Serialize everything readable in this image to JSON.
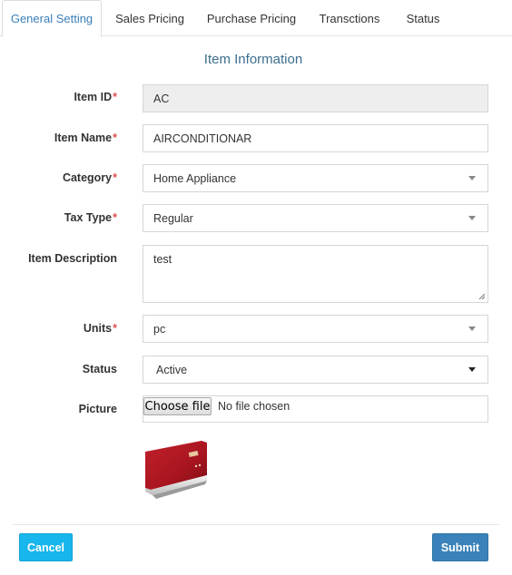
{
  "tabs": [
    {
      "label": "General Setting",
      "active": true
    },
    {
      "label": "Sales Pricing",
      "active": false
    },
    {
      "label": "Purchase Pricing",
      "active": false
    },
    {
      "label": "Transctions",
      "active": false
    },
    {
      "label": "Status",
      "active": false
    }
  ],
  "form": {
    "title": "Item Information",
    "item_id": {
      "label": "Item ID",
      "required_mark": "*",
      "value": "AC"
    },
    "item_name": {
      "label": "Item Name",
      "required_mark": "*",
      "value": "AIRCONDITIONAR"
    },
    "category": {
      "label": "Category",
      "required_mark": "*",
      "value": "Home Appliance"
    },
    "tax_type": {
      "label": "Tax Type",
      "required_mark": "*",
      "value": "Regular"
    },
    "description": {
      "label": "Item Description",
      "value": "test"
    },
    "units": {
      "label": "Units",
      "required_mark": "*",
      "value": "pc"
    },
    "status": {
      "label": "Status",
      "value": "Active"
    },
    "picture": {
      "label": "Picture",
      "button_label": "Choose file",
      "file_text": "No file chosen",
      "preview": "air-conditioner-image"
    }
  },
  "actions": {
    "cancel_label": "Cancel",
    "submit_label": "Submit"
  },
  "colors": {
    "accent": "#3a7fb8",
    "required": "#d9534f",
    "cancel": "#17b6ec",
    "submit": "#3a82b9"
  }
}
